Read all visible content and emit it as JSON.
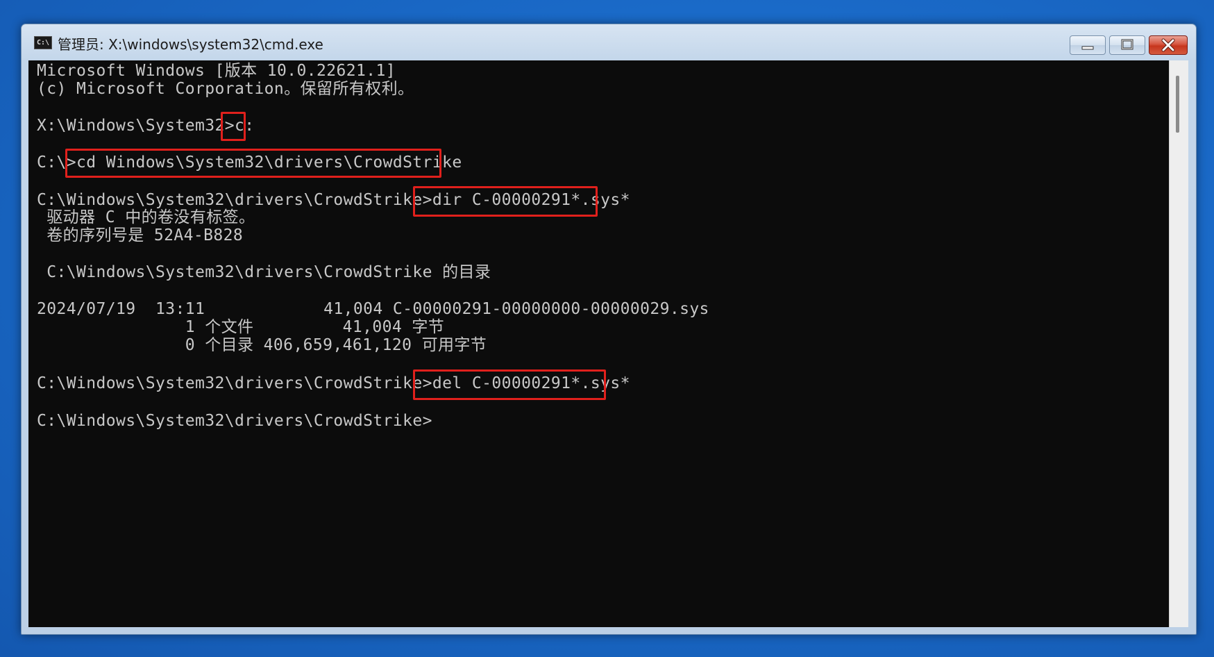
{
  "window": {
    "title": "管理员: X:\\windows\\system32\\cmd.exe",
    "icon_text": "C:\\"
  },
  "console": {
    "lines": [
      "Microsoft Windows [版本 10.0.22621.1]",
      "(c) Microsoft Corporation。保留所有权利。",
      "X:\\Windows\\System32>c:",
      "C:\\>cd Windows\\System32\\drivers\\CrowdStrike",
      "C:\\Windows\\System32\\drivers\\CrowdStrike>dir C-00000291*.sys*",
      " 驱动器 C 中的卷没有标签。",
      " 卷的序列号是 52A4-B828",
      " C:\\Windows\\System32\\drivers\\CrowdStrike 的目录",
      "2024/07/19  13:11            41,004 C-00000291-00000000-00000029.sys",
      "               1 个文件         41,004 字节",
      "               0 个目录 406,659,461,120 可用字节",
      "C:\\Windows\\System32\\drivers\\CrowdStrike>del C-00000291*.sys*",
      "C:\\Windows\\System32\\drivers\\CrowdStrike>"
    ]
  },
  "highlights": [
    "c:",
    "cd Windows\\System32\\drivers\\CrowdStrike",
    "dir C-00000291*.sys*",
    "del C-00000291*.sys*"
  ],
  "colors": {
    "console_bg": "#0c0c0c",
    "console_text": "#c8c8c8",
    "highlight_border": "#e0201c",
    "desktop": "#1a6ac8"
  },
  "icons": {
    "app": "cmd-icon",
    "minimize": "minimize-icon",
    "maximize": "maximize-icon",
    "close": "close-icon"
  }
}
